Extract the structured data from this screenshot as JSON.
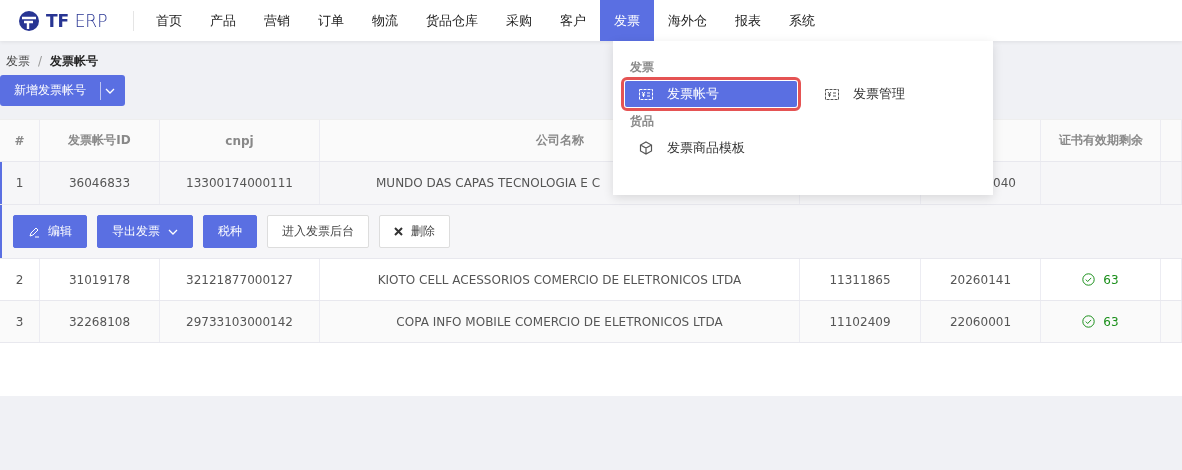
{
  "logo": {
    "bold": "TF",
    "light": "ERP"
  },
  "nav": [
    {
      "label": "首页",
      "selected": false
    },
    {
      "label": "产品",
      "selected": false
    },
    {
      "label": "营销",
      "selected": false
    },
    {
      "label": "订单",
      "selected": false
    },
    {
      "label": "物流",
      "selected": false
    },
    {
      "label": "货品仓库",
      "selected": false
    },
    {
      "label": "采购",
      "selected": false
    },
    {
      "label": "客户",
      "selected": false
    },
    {
      "label": "发票",
      "selected": true
    },
    {
      "label": "海外仓",
      "selected": false
    },
    {
      "label": "报表",
      "selected": false
    },
    {
      "label": "系统",
      "selected": false
    }
  ],
  "breadcrumb": {
    "parent": "发票",
    "separator": "/",
    "current": "发票帐号"
  },
  "add_button": {
    "label": "新增发票帐号"
  },
  "table": {
    "columns": [
      "#",
      "发票帐号ID",
      "cnpj",
      "公司名称",
      "",
      "",
      "证书有效期剩余",
      ""
    ],
    "rows": [
      {
        "cells": [
          "1",
          "36046833",
          "13300174000111",
          "MUNDO DAS CAPAS TECNOLOGIA E C",
          "",
          "040",
          "",
          ""
        ],
        "expanded": true
      },
      {
        "cells": [
          "2",
          "31019178",
          "32121877000127",
          "KIOTO CELL ACESSORIOS COMERCIO DE ELETRONICOS LTDA",
          "11311865",
          "20260141",
          "63",
          ""
        ],
        "expanded": false,
        "valid": true
      },
      {
        "cells": [
          "3",
          "32268108",
          "29733103000142",
          "COPA INFO MOBILE COMERCIO DE ELETRONICOS LTDA",
          "11102409",
          "22060001",
          "63",
          ""
        ],
        "expanded": false,
        "valid": true
      }
    ],
    "actions": [
      {
        "label": "编辑",
        "kind": "edit"
      },
      {
        "label": "导出发票",
        "kind": "dropdown"
      },
      {
        "label": "税种",
        "kind": "primary"
      },
      {
        "label": "进入发票后台",
        "kind": "plain"
      },
      {
        "label": "删除",
        "kind": "delete"
      }
    ]
  },
  "menu": {
    "sections": [
      {
        "title": "发票",
        "items": [
          {
            "label": "发票帐号",
            "kind": "invoice",
            "selected": true,
            "highlighted": true
          },
          {
            "label": "发票管理",
            "kind": "invoice",
            "selected": false,
            "highlighted": false
          }
        ]
      },
      {
        "title": "货品",
        "items": [
          {
            "label": "发票商品模板",
            "kind": "cube",
            "selected": false,
            "highlighted": false
          }
        ]
      }
    ]
  }
}
